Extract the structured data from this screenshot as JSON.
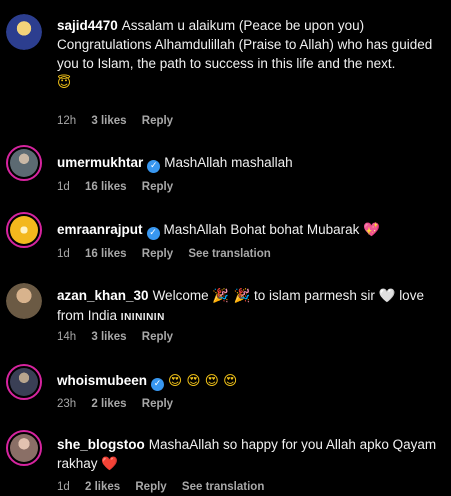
{
  "comments": [
    {
      "username": "sajid4470",
      "text": "Assalam u alaikum (Peace be upon you) Congratulations  Alhamdulillah (Praise to Allah) who has guided you to Islam, the path to success in this life and the next.",
      "emoji_line": "😇",
      "time": "12h",
      "likes": "3 likes",
      "reply": "Reply",
      "avatar_color": "#2c3e8f"
    },
    {
      "username": "umermukhtar",
      "verified": true,
      "text": "MashAllah mashallah",
      "time": "1d",
      "likes": "16 likes",
      "reply": "Reply",
      "avatar_color": "#5c6a72"
    },
    {
      "username": "emraanrajput",
      "verified": true,
      "text": "MashAllah Bohat bohat Mubarak",
      "text_emoji": "💖",
      "time": "1d",
      "likes": "16 likes",
      "reply": "Reply",
      "translate": "See translation",
      "avatar_color": "#f3b81d"
    },
    {
      "username": "azan_khan_30",
      "text_before": "Welcome",
      "emoji_party": "🎉 🎉",
      "text_middle": "to islam parmesh sir",
      "emoji_heart": "🤍",
      "text_after": "love from India",
      "text_tail": "ININININ",
      "time": "14h",
      "likes": "3 likes",
      "reply": "Reply",
      "avatar_color": "#6b5a44"
    },
    {
      "username": "whoismubeen",
      "verified": true,
      "emoji_text": "😍 😍 😍 😍",
      "time": "23h",
      "likes": "2 likes",
      "reply": "Reply",
      "avatar_color": "#3a3f55"
    },
    {
      "username": "she_blogstoo",
      "text": "MashaAllah so happy for you Allah apko Qayam rakhay",
      "text_emoji": "❤️",
      "time": "1d",
      "likes": "2 likes",
      "reply": "Reply",
      "translate": "See translation",
      "avatar_color": "#8a6f66"
    }
  ]
}
